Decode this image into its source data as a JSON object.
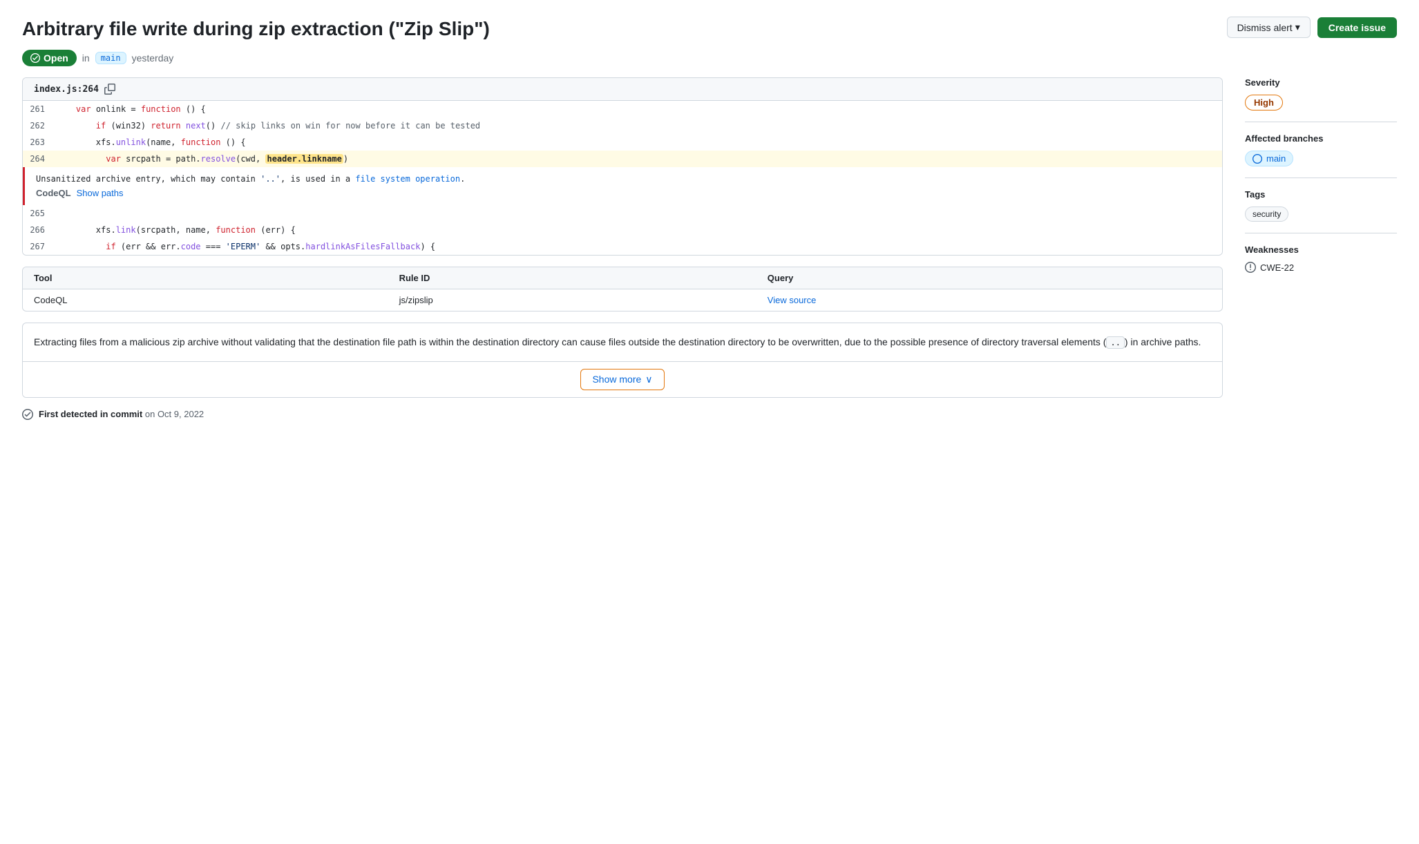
{
  "page": {
    "title": "Arbitrary file write during zip extraction (\"Zip Slip\")",
    "status": "Open",
    "branch": "main",
    "time": "yesterday",
    "in_text": "in"
  },
  "header": {
    "dismiss_label": "Dismiss alert",
    "create_label": "Create issue"
  },
  "code": {
    "file": "index.js:264",
    "lines": [
      {
        "num": "261",
        "highlighted": false
      },
      {
        "num": "262",
        "highlighted": false
      },
      {
        "num": "263",
        "highlighted": false
      },
      {
        "num": "264",
        "highlighted": true
      }
    ]
  },
  "alert": {
    "text": "Unsanitized archive entry, which may contain '..', is used in a file system operation.",
    "source": "CodeQL",
    "show_paths": "Show paths"
  },
  "tool": {
    "col_tool": "Tool",
    "col_rule_id": "Rule ID",
    "col_query": "Query",
    "row_tool": "CodeQL",
    "row_rule_id": "js/zipslip",
    "row_query": "View source"
  },
  "description": {
    "text": "Extracting files from a malicious zip archive without validating that the destination file path is within the destination directory can cause files outside the destination directory to be overwritten, due to the possible presence of directory traversal elements ( .. ) in archive paths.",
    "show_more": "Show more"
  },
  "first_detected": {
    "label": "First detected in commit",
    "date": "on Oct 9, 2022"
  },
  "sidebar": {
    "severity_label": "Severity",
    "severity_value": "High",
    "branches_label": "Affected branches",
    "branch_name": "main",
    "tags_label": "Tags",
    "tag_value": "security",
    "weaknesses_label": "Weaknesses",
    "weakness_value": "CWE-22"
  }
}
